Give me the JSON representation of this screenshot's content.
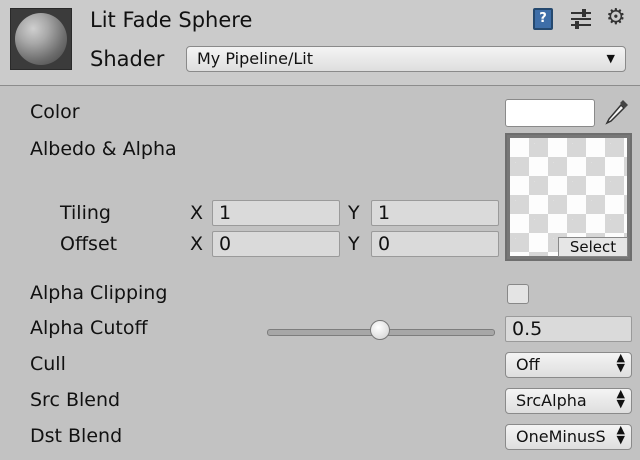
{
  "header": {
    "material_name": "Lit Fade Sphere",
    "shader_label": "Shader",
    "shader_value": "My Pipeline/Lit",
    "icons": [
      "book-help-icon",
      "sliders-icon",
      "gear-icon"
    ]
  },
  "properties": {
    "color_label": "Color",
    "color_value": "#ffffff",
    "albedo_label": "Albedo & Alpha",
    "texture_select_label": "Select",
    "tiling_label": "Tiling",
    "offset_label": "Offset",
    "x_label": "X",
    "y_label": "Y",
    "tiling_x": "1",
    "tiling_y": "1",
    "offset_x": "0",
    "offset_y": "0",
    "alpha_clipping_label": "Alpha Clipping",
    "alpha_clipping_checked": false,
    "alpha_cutoff_label": "Alpha Cutoff",
    "alpha_cutoff_value": "0.5",
    "alpha_cutoff_fraction": 0.5,
    "cull_label": "Cull",
    "cull_value": "Off",
    "src_blend_label": "Src Blend",
    "src_blend_value": "SrcAlpha",
    "dst_blend_label": "Dst Blend",
    "dst_blend_value": "OneMinusS"
  }
}
